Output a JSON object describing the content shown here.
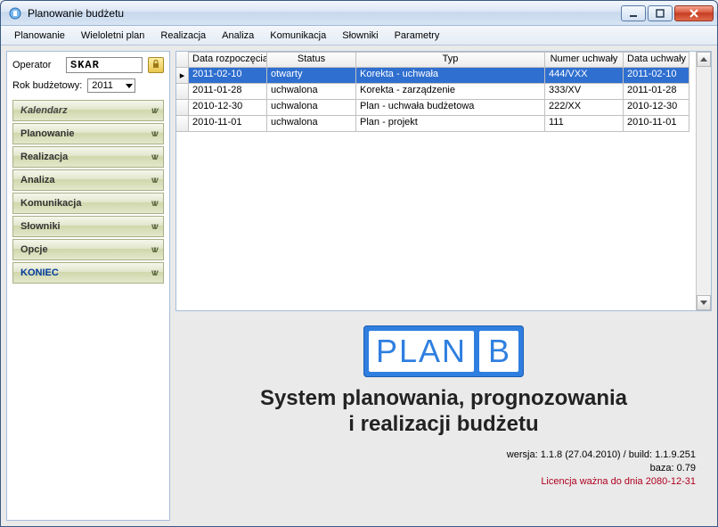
{
  "window": {
    "title": "Planowanie budżetu"
  },
  "menu": {
    "items": [
      "Planowanie",
      "Wieloletni plan",
      "Realizacja",
      "Analiza",
      "Komunikacja",
      "Słowniki",
      "Parametry"
    ]
  },
  "sidebar": {
    "operator_label": "Operator",
    "operator_value": "SKAR",
    "year_label": "Rok budżetowy:",
    "year_value": "2011",
    "accordion": [
      {
        "label": "Kalendarz",
        "key": "calendar"
      },
      {
        "label": "Planowanie",
        "key": "planowanie"
      },
      {
        "label": "Realizacja",
        "key": "realizacja"
      },
      {
        "label": "Analiza",
        "key": "analiza"
      },
      {
        "label": "Komunikacja",
        "key": "komunikacja"
      },
      {
        "label": "Słowniki",
        "key": "slowniki"
      },
      {
        "label": "Opcje",
        "key": "opcje"
      },
      {
        "label": "KONIEC",
        "key": "koniec"
      }
    ]
  },
  "grid": {
    "columns": {
      "date": "Data rozpoczęcia",
      "status": "Status",
      "type": "Typ",
      "num": "Numer uchwały",
      "uch": "Data uchwały"
    },
    "rows": [
      {
        "date": "2011-02-10",
        "status": "otwarty",
        "type": "Korekta - uchwała",
        "num": "444/VXX",
        "uch": "2011-02-10",
        "selected": true
      },
      {
        "date": "2011-01-28",
        "status": "uchwalona",
        "type": "Korekta - zarządzenie",
        "num": "333/XV",
        "uch": "2011-01-28",
        "selected": false
      },
      {
        "date": "2010-12-30",
        "status": "uchwalona",
        "type": "Plan - uchwała budżetowa",
        "num": "222/XX",
        "uch": "2010-12-30",
        "selected": false
      },
      {
        "date": "2010-11-01",
        "status": "uchwalona",
        "type": "Plan - projekt",
        "num": "111",
        "uch": "2010-11-01",
        "selected": false
      }
    ]
  },
  "splash": {
    "logo_plan": "PLAN",
    "logo_b": "B",
    "tagline1": "System planowania, prognozowania",
    "tagline2": "i realizacji budżetu",
    "version": "wersja: 1.1.8 (27.04.2010) / build: 1.1.9.251",
    "baza": "baza: 0.79",
    "licencja": "Licencja ważna do dnia 2080-12-31"
  }
}
